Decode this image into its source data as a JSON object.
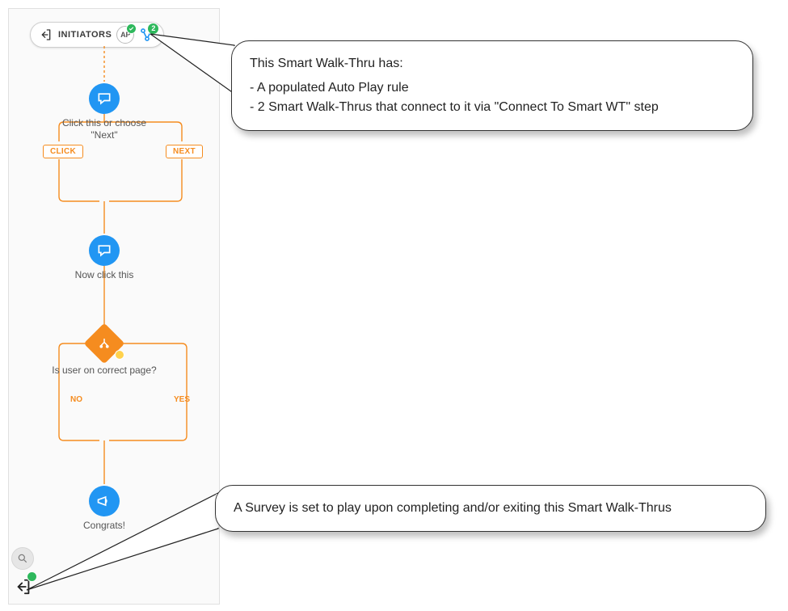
{
  "initiators": {
    "label": "INITIATORS",
    "ap_badge": "AP",
    "connect_count": "2"
  },
  "steps": {
    "step1_label": "Click this or choose \"Next\"",
    "click_pill": "CLICK",
    "next_pill": "NEXT",
    "step2_label": "Now click this",
    "split_question": "Is user on correct page?",
    "branch_no": "NO",
    "branch_yes": "YES",
    "step3_label": "Congrats!"
  },
  "callouts": {
    "top_line1": "This Smart Walk-Thru has:",
    "top_bullet1": "- A populated Auto Play rule",
    "top_bullet2": "- 2 Smart Walk-Thrus that connect to it via \"Connect To Smart WT\" step",
    "bottom_text": "A Survey is set to play upon completing and/or exiting this Smart Walk-Thrus"
  }
}
